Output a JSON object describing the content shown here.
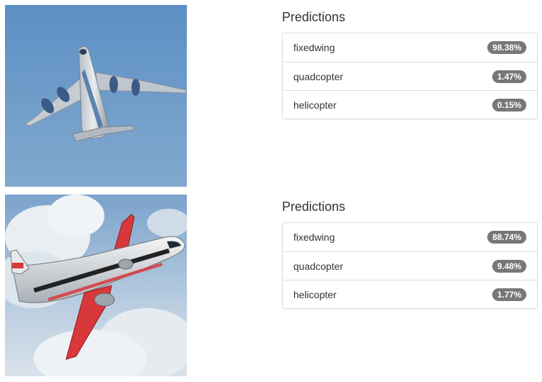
{
  "results": [
    {
      "image_alt": "airplane-photo-1",
      "title": "Predictions",
      "predictions": [
        {
          "label": "fixedwing",
          "value": "98.38%"
        },
        {
          "label": "quadcopter",
          "value": "1.47%"
        },
        {
          "label": "helicopter",
          "value": "0.15%"
        }
      ]
    },
    {
      "image_alt": "airplane-photo-2",
      "title": "Predictions",
      "predictions": [
        {
          "label": "fixedwing",
          "value": "88.74%"
        },
        {
          "label": "quadcopter",
          "value": "9.48%"
        },
        {
          "label": "helicopter",
          "value": "1.77%"
        }
      ]
    }
  ],
  "colors": {
    "badge": "#777777",
    "border": "#dddddd",
    "text": "#333333",
    "sky_blue": "#6f9cc9",
    "cloud": "#e8edf2",
    "livery_red": "#d8383a"
  }
}
